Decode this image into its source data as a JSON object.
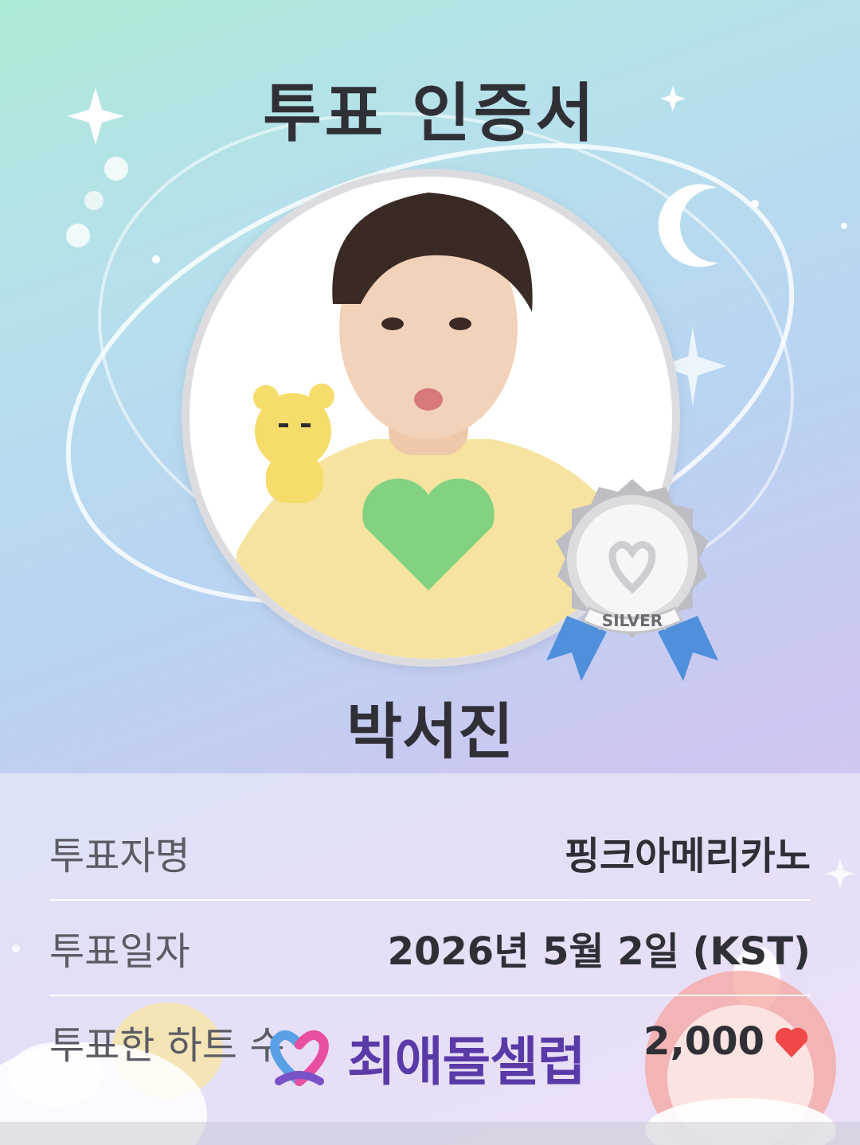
{
  "certificate": {
    "title": "투표 인증서",
    "candidate_name": "박서진",
    "medal_label": "SILVER"
  },
  "info": {
    "rows": [
      {
        "label": "투표자명",
        "value": "핑크아메리카노"
      },
      {
        "label": "투표일자",
        "value": "2026년 5월 2일 (KST)"
      },
      {
        "label": "투표한 하트 수",
        "value": "2,000"
      }
    ]
  },
  "branding": {
    "app_name": "최애돌셀럽"
  },
  "icons": {
    "heart": "heart-icon",
    "medal": "silver-medal-icon",
    "logo": "choeaedol-logo-icon"
  },
  "colors": {
    "title": "#2f2f36",
    "heart": "#f04848",
    "brand": "#5a3aa8",
    "medal_ribbon": "#4f8fdc"
  }
}
